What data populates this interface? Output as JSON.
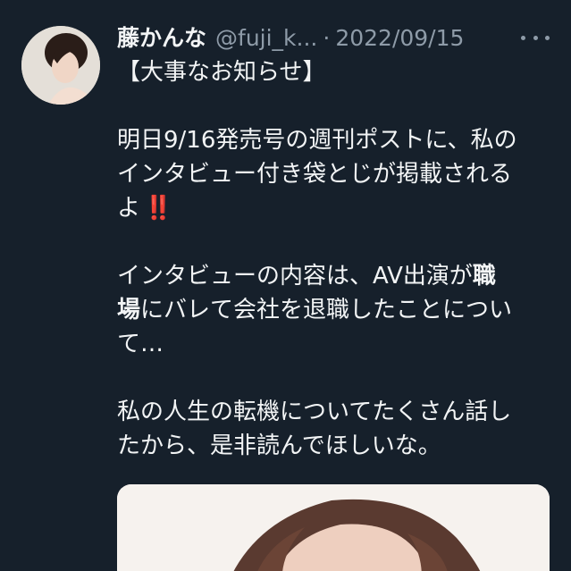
{
  "tweet": {
    "display_name": "藤かんな",
    "handle": "@fuji_k...",
    "separator": "·",
    "date": "2022/09/15",
    "more_icon": "more-horizontal-icon",
    "lines": {
      "l1": "【大事なお知らせ】",
      "l2": "明日9/16発売号の週刊ポストに、私の",
      "l3": "インタビュー付き袋とじが掲載される",
      "l4": "よ",
      "l4_emoji": "‼️",
      "l5_a": "インタビューの内容は、AV出演が",
      "l5_b": "職",
      "l6_a": "場",
      "l6_b": "にバレて会社を退職したことについ",
      "l7": "て…",
      "l8": "私の人生の転機についてたくさん話し",
      "l9": "たから、是非読んでほしいな。"
    },
    "colors": {
      "background": "#16202b",
      "text": "#f2f4f5",
      "secondary": "#8e9ba8",
      "emoji_red": "#e0323d"
    }
  }
}
